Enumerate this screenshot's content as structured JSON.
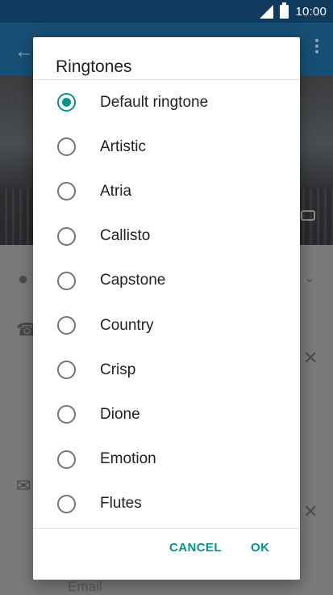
{
  "status_bar": {
    "time": "10:00"
  },
  "background": {
    "email_placeholder": "Email"
  },
  "dialog": {
    "title": "Ringtones",
    "selected_index": 0,
    "items": [
      {
        "label": "Default ringtone",
        "checked": true
      },
      {
        "label": "Artistic",
        "checked": false
      },
      {
        "label": "Atria",
        "checked": false
      },
      {
        "label": "Callisto",
        "checked": false
      },
      {
        "label": "Capstone",
        "checked": false
      },
      {
        "label": "Country",
        "checked": false
      },
      {
        "label": "Crisp",
        "checked": false
      },
      {
        "label": "Dione",
        "checked": false
      },
      {
        "label": "Emotion",
        "checked": false
      },
      {
        "label": "Flutes",
        "checked": false
      }
    ],
    "cancel_label": "CANCEL",
    "ok_label": "OK"
  },
  "colors": {
    "accent": "#009688",
    "status_bar": "#0f3a5e",
    "toolbar": "#174f75"
  },
  "icons": [
    "signal-icon",
    "battery-icon",
    "back-arrow-icon",
    "overflow-menu-icon",
    "camera-icon",
    "person-icon",
    "phone-icon",
    "email-icon",
    "clear-icon",
    "chevron-down-icon"
  ]
}
